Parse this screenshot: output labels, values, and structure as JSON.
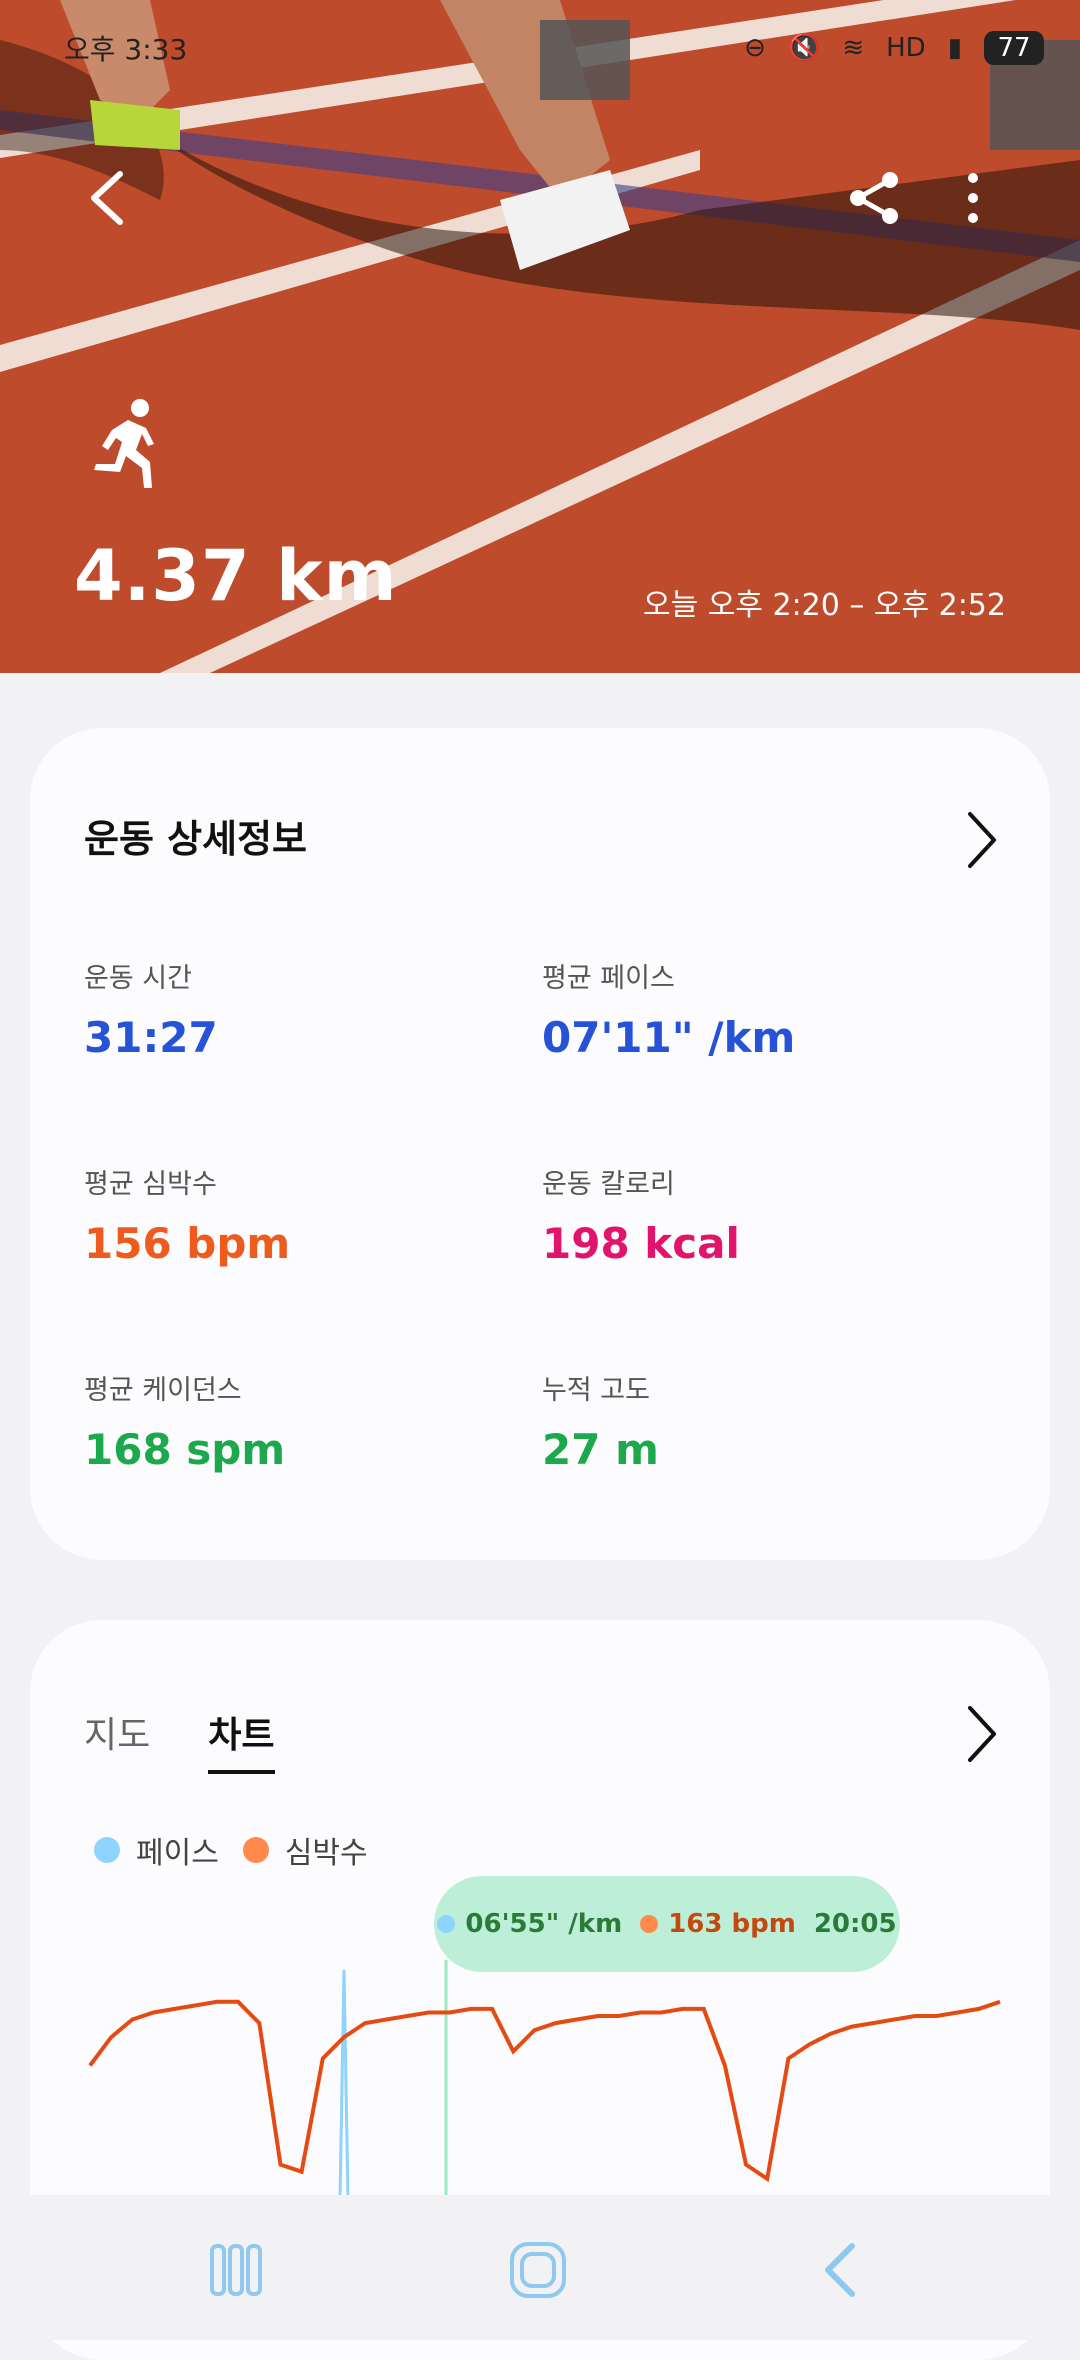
{
  "status": {
    "time": "오후 3:33",
    "icons": [
      "do-not-disturb-icon",
      "mute-icon",
      "wifi-icon",
      "hd-icon",
      "signal-icon"
    ],
    "battery": "77"
  },
  "hero": {
    "distance": "4.37 km",
    "time_range": "오늘 오후 2:20 – 오후 2:52",
    "activity_icon": "running-icon"
  },
  "details": {
    "title": "운동 상세정보",
    "stats": [
      {
        "label": "운동 시간",
        "value": "31:27",
        "color": "#2552d6"
      },
      {
        "label": "평균 페이스",
        "value": "07'11\" /km",
        "color": "#2552d6"
      },
      {
        "label": "평균 심박수",
        "value": "156 bpm",
        "color": "#ee5b1f"
      },
      {
        "label": "운동 칼로리",
        "value": "198 kcal",
        "color": "#e2136a"
      },
      {
        "label": "평균 케이던스",
        "value": "168 spm",
        "color": "#1ea84d"
      },
      {
        "label": "누적 고도",
        "value": "27 m",
        "color": "#1ea84d"
      }
    ]
  },
  "chart_card": {
    "tabs": [
      "지도",
      "차트"
    ],
    "active_tab": "차트",
    "legend": [
      {
        "name": "페이스",
        "color": "#8fd3ff"
      },
      {
        "name": "심박수",
        "color": "#ff8a4c"
      }
    ],
    "tooltip": {
      "pace": "06'55\" /km",
      "heart_rate": "163 bpm",
      "time": "20:05"
    }
  },
  "chart_data": {
    "type": "line",
    "series": [
      {
        "name": "심박수",
        "color": "#e54a12",
        "values": [
          118,
          126,
          131,
          133,
          134,
          135,
          136,
          136,
          130,
          90,
          88,
          120,
          126,
          130,
          131,
          132,
          133,
          133,
          134,
          134,
          122,
          128,
          130,
          131,
          132,
          132,
          133,
          133,
          134,
          134,
          118,
          90,
          86,
          120,
          124,
          127,
          129,
          130,
          131,
          132,
          132,
          133,
          134,
          136
        ]
      },
      {
        "name": "페이스",
        "color": "#8fd3ff",
        "values": []
      }
    ]
  },
  "navbar": {
    "recent": "recent-apps-icon",
    "home": "home-icon",
    "back": "back-icon"
  }
}
